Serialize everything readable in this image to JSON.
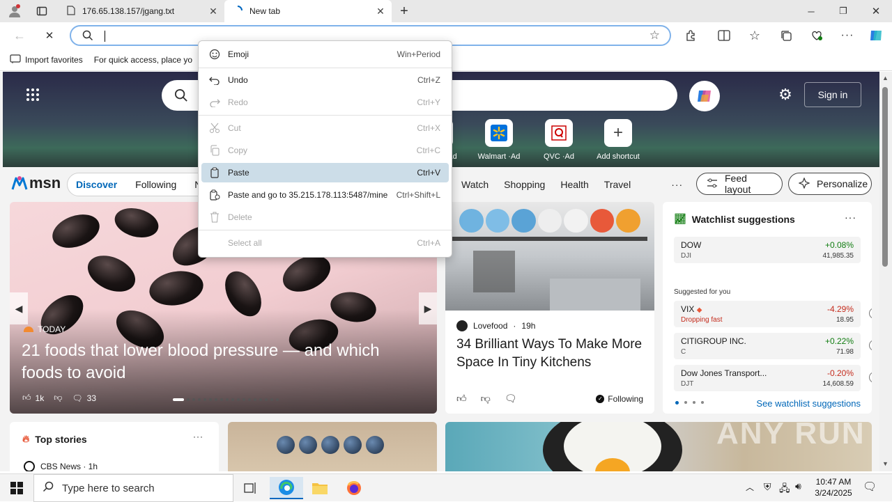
{
  "browser": {
    "tabs": [
      {
        "title": "176.65.138.157/jgang.txt"
      },
      {
        "title": "New tab"
      }
    ],
    "favorites": {
      "import_label": "Import favorites",
      "hint": "For quick access, place yo"
    }
  },
  "context_menu": {
    "items": [
      {
        "label": "Emoji",
        "shortcut": "Win+Period",
        "enabled": true,
        "icon": "emoji-icon"
      },
      {
        "label": "Undo",
        "shortcut": "Ctrl+Z",
        "enabled": true,
        "icon": "undo-icon"
      },
      {
        "label": "Redo",
        "shortcut": "Ctrl+Y",
        "enabled": false,
        "icon": "redo-icon"
      },
      {
        "label": "Cut",
        "shortcut": "Ctrl+X",
        "enabled": false,
        "icon": "cut-icon"
      },
      {
        "label": "Copy",
        "shortcut": "Ctrl+C",
        "enabled": false,
        "icon": "copy-icon"
      },
      {
        "label": "Paste",
        "shortcut": "Ctrl+V",
        "enabled": true,
        "highlighted": true,
        "icon": "paste-icon"
      },
      {
        "label": "Paste and go to 35.215.178.113:5487/mine",
        "shortcut": "Ctrl+Shift+L",
        "enabled": true,
        "icon": "paste-go-icon"
      },
      {
        "label": "Delete",
        "shortcut": "",
        "enabled": false,
        "icon": "delete-icon"
      },
      {
        "label": "Select all",
        "shortcut": "Ctrl+A",
        "enabled": false,
        "icon": ""
      }
    ]
  },
  "msn": {
    "signin": "Sign in",
    "shortcuts": [
      {
        "label": "Ad",
        "icon": "partial-shortcut"
      },
      {
        "label": "Walmart ·Ad",
        "icon": "walmart-icon"
      },
      {
        "label": "QVC ·Ad",
        "icon": "qvc-icon"
      },
      {
        "label": "Add shortcut",
        "icon": "plus-icon"
      }
    ],
    "nav": {
      "logo": "msn",
      "pill": [
        "Discover",
        "Following",
        "N"
      ],
      "items": [
        "Watch",
        "Shopping",
        "Health",
        "Travel"
      ],
      "more": "···",
      "feed_layout": "Feed layout",
      "personalize": "Personalize"
    },
    "hero": {
      "source": "TODAY",
      "headline": "21 foods that lower blood pressure — and which foods to avoid",
      "likes": "1k",
      "comments": "33"
    },
    "article": {
      "source": "Lovefood",
      "age": "19h",
      "headline": "34 Brilliant Ways To Make More Space In Tiny Kitchens",
      "following": "Following"
    },
    "watchlist": {
      "title": "Watchlist suggestions",
      "rows": [
        {
          "name": "DOW",
          "sub": "DJI",
          "change": "+0.08%",
          "value": "41,985.35",
          "dir": "pos"
        },
        {
          "name": "VIX",
          "sub": "Dropping fast",
          "change": "-4.29%",
          "value": "18.95",
          "dir": "neg"
        },
        {
          "name": "CITIGROUP INC.",
          "sub": "C",
          "change": "+0.22%",
          "value": "71.98",
          "dir": "pos"
        },
        {
          "name": "Dow Jones Transport...",
          "sub": "DJT",
          "change": "-0.20%",
          "value": "14,608.59",
          "dir": "neg"
        }
      ],
      "suggested_label": "Suggested for you",
      "see_more": "See watchlist suggestions"
    },
    "top_stories": {
      "title": "Top stories",
      "source": "CBS News · 1h"
    }
  },
  "watermark": "ANY RUN",
  "taskbar": {
    "search_placeholder": "Type here to search",
    "time": "10:47 AM",
    "date": "3/24/2025"
  }
}
